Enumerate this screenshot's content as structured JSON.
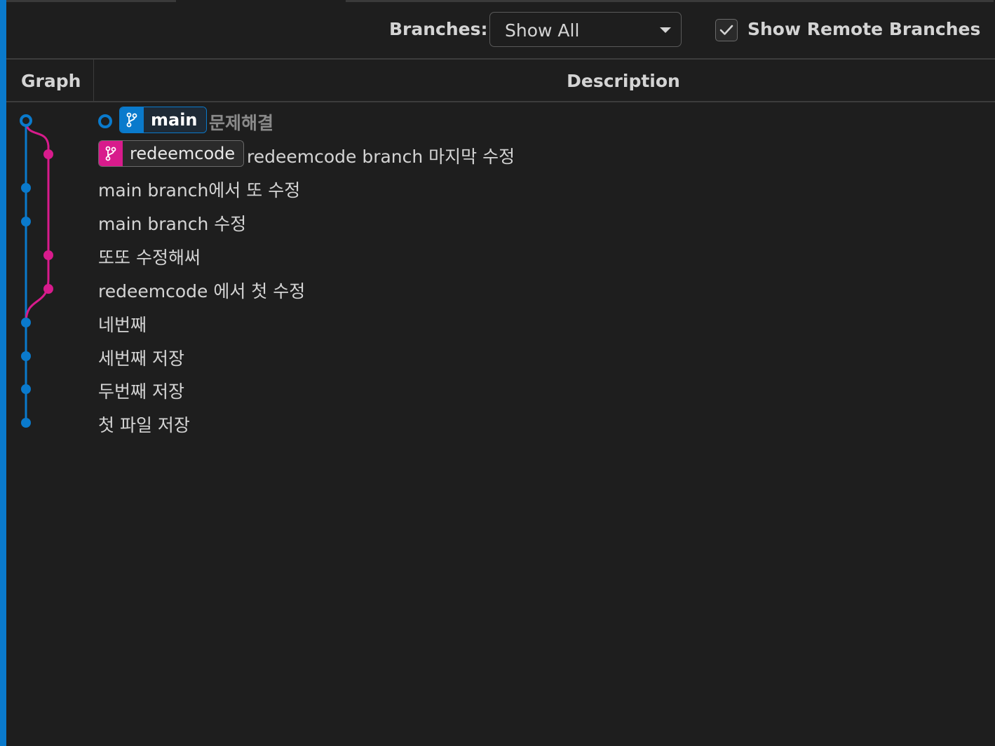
{
  "controls": {
    "branches_label": "Branches:",
    "branch_select_value": "Show All",
    "show_remote_label": "Show Remote Branches",
    "show_remote_checked": true
  },
  "table": {
    "columns": [
      "Graph",
      "Description"
    ]
  },
  "colors": {
    "main_branch": "#0a7acc",
    "redeemcode_branch": "#d81b8c",
    "background": "#1e1e1e"
  },
  "commits": [
    {
      "description": "문제해결",
      "refs": [
        "main"
      ],
      "branch": "main",
      "uncommitted": true
    },
    {
      "description": "redeemcode branch 마지막 수정",
      "refs": [
        "redeemcode"
      ],
      "branch": "redeemcode"
    },
    {
      "description": "main branch에서 또 수정",
      "refs": [],
      "branch": "main"
    },
    {
      "description": "main branch 수정",
      "refs": [],
      "branch": "main"
    },
    {
      "description": "또또 수정해써",
      "refs": [],
      "branch": "redeemcode"
    },
    {
      "description": "redeemcode 에서 첫 수정",
      "refs": [],
      "branch": "redeemcode"
    },
    {
      "description": "네번째",
      "refs": [],
      "branch": "main"
    },
    {
      "description": "세번째 저장",
      "refs": [],
      "branch": "main"
    },
    {
      "description": "두번째 저장",
      "refs": [],
      "branch": "main"
    },
    {
      "description": "첫 파일 저장",
      "refs": [],
      "branch": "main"
    }
  ],
  "icons": {
    "branch_ref": "git-branch-icon",
    "dropdown": "chevron-down-icon",
    "checkbox": "checkmark-icon"
  }
}
